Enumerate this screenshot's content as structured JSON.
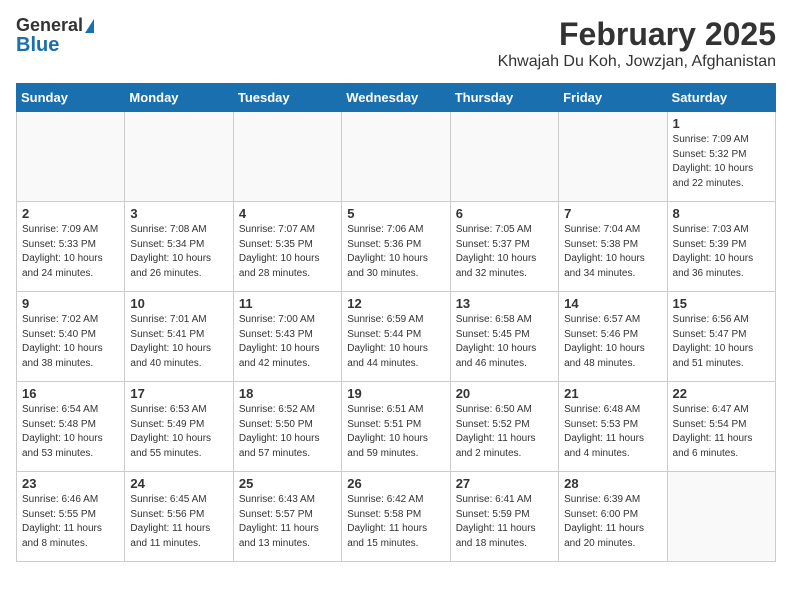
{
  "header": {
    "logo_general": "General",
    "logo_blue": "Blue",
    "month": "February 2025",
    "location": "Khwajah Du Koh, Jowzjan, Afghanistan"
  },
  "weekdays": [
    "Sunday",
    "Monday",
    "Tuesday",
    "Wednesday",
    "Thursday",
    "Friday",
    "Saturday"
  ],
  "weeks": [
    [
      {
        "day": "",
        "info": ""
      },
      {
        "day": "",
        "info": ""
      },
      {
        "day": "",
        "info": ""
      },
      {
        "day": "",
        "info": ""
      },
      {
        "day": "",
        "info": ""
      },
      {
        "day": "",
        "info": ""
      },
      {
        "day": "1",
        "info": "Sunrise: 7:09 AM\nSunset: 5:32 PM\nDaylight: 10 hours\nand 22 minutes."
      }
    ],
    [
      {
        "day": "2",
        "info": "Sunrise: 7:09 AM\nSunset: 5:33 PM\nDaylight: 10 hours\nand 24 minutes."
      },
      {
        "day": "3",
        "info": "Sunrise: 7:08 AM\nSunset: 5:34 PM\nDaylight: 10 hours\nand 26 minutes."
      },
      {
        "day": "4",
        "info": "Sunrise: 7:07 AM\nSunset: 5:35 PM\nDaylight: 10 hours\nand 28 minutes."
      },
      {
        "day": "5",
        "info": "Sunrise: 7:06 AM\nSunset: 5:36 PM\nDaylight: 10 hours\nand 30 minutes."
      },
      {
        "day": "6",
        "info": "Sunrise: 7:05 AM\nSunset: 5:37 PM\nDaylight: 10 hours\nand 32 minutes."
      },
      {
        "day": "7",
        "info": "Sunrise: 7:04 AM\nSunset: 5:38 PM\nDaylight: 10 hours\nand 34 minutes."
      },
      {
        "day": "8",
        "info": "Sunrise: 7:03 AM\nSunset: 5:39 PM\nDaylight: 10 hours\nand 36 minutes."
      }
    ],
    [
      {
        "day": "9",
        "info": "Sunrise: 7:02 AM\nSunset: 5:40 PM\nDaylight: 10 hours\nand 38 minutes."
      },
      {
        "day": "10",
        "info": "Sunrise: 7:01 AM\nSunset: 5:41 PM\nDaylight: 10 hours\nand 40 minutes."
      },
      {
        "day": "11",
        "info": "Sunrise: 7:00 AM\nSunset: 5:43 PM\nDaylight: 10 hours\nand 42 minutes."
      },
      {
        "day": "12",
        "info": "Sunrise: 6:59 AM\nSunset: 5:44 PM\nDaylight: 10 hours\nand 44 minutes."
      },
      {
        "day": "13",
        "info": "Sunrise: 6:58 AM\nSunset: 5:45 PM\nDaylight: 10 hours\nand 46 minutes."
      },
      {
        "day": "14",
        "info": "Sunrise: 6:57 AM\nSunset: 5:46 PM\nDaylight: 10 hours\nand 48 minutes."
      },
      {
        "day": "15",
        "info": "Sunrise: 6:56 AM\nSunset: 5:47 PM\nDaylight: 10 hours\nand 51 minutes."
      }
    ],
    [
      {
        "day": "16",
        "info": "Sunrise: 6:54 AM\nSunset: 5:48 PM\nDaylight: 10 hours\nand 53 minutes."
      },
      {
        "day": "17",
        "info": "Sunrise: 6:53 AM\nSunset: 5:49 PM\nDaylight: 10 hours\nand 55 minutes."
      },
      {
        "day": "18",
        "info": "Sunrise: 6:52 AM\nSunset: 5:50 PM\nDaylight: 10 hours\nand 57 minutes."
      },
      {
        "day": "19",
        "info": "Sunrise: 6:51 AM\nSunset: 5:51 PM\nDaylight: 10 hours\nand 59 minutes."
      },
      {
        "day": "20",
        "info": "Sunrise: 6:50 AM\nSunset: 5:52 PM\nDaylight: 11 hours\nand 2 minutes."
      },
      {
        "day": "21",
        "info": "Sunrise: 6:48 AM\nSunset: 5:53 PM\nDaylight: 11 hours\nand 4 minutes."
      },
      {
        "day": "22",
        "info": "Sunrise: 6:47 AM\nSunset: 5:54 PM\nDaylight: 11 hours\nand 6 minutes."
      }
    ],
    [
      {
        "day": "23",
        "info": "Sunrise: 6:46 AM\nSunset: 5:55 PM\nDaylight: 11 hours\nand 8 minutes."
      },
      {
        "day": "24",
        "info": "Sunrise: 6:45 AM\nSunset: 5:56 PM\nDaylight: 11 hours\nand 11 minutes."
      },
      {
        "day": "25",
        "info": "Sunrise: 6:43 AM\nSunset: 5:57 PM\nDaylight: 11 hours\nand 13 minutes."
      },
      {
        "day": "26",
        "info": "Sunrise: 6:42 AM\nSunset: 5:58 PM\nDaylight: 11 hours\nand 15 minutes."
      },
      {
        "day": "27",
        "info": "Sunrise: 6:41 AM\nSunset: 5:59 PM\nDaylight: 11 hours\nand 18 minutes."
      },
      {
        "day": "28",
        "info": "Sunrise: 6:39 AM\nSunset: 6:00 PM\nDaylight: 11 hours\nand 20 minutes."
      },
      {
        "day": "",
        "info": ""
      }
    ]
  ]
}
